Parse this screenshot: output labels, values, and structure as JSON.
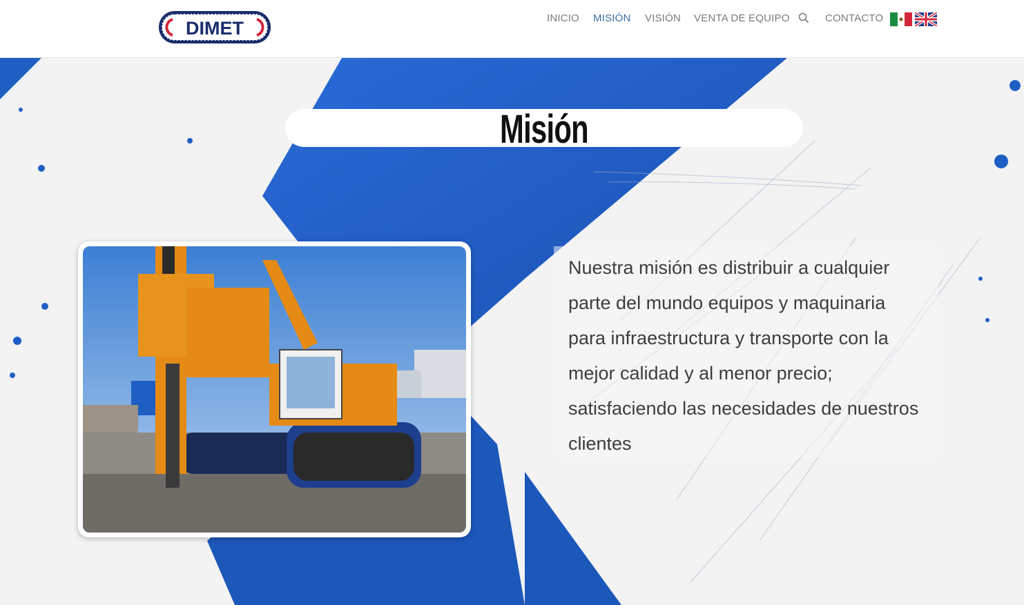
{
  "header": {
    "logo_text": "DIMET",
    "nav": [
      {
        "label": "INICIO",
        "active": false
      },
      {
        "label": "MISIÓN",
        "active": true
      },
      {
        "label": "VISIÓN",
        "active": false
      },
      {
        "label": "VENTA DE EQUIPO",
        "active": false
      },
      {
        "label": "CONTACTO",
        "active": false
      }
    ],
    "search_icon": "search-icon",
    "flags": [
      "mexico-flag-icon",
      "uk-flag-icon"
    ]
  },
  "main": {
    "title": "Misión",
    "mission_text": "Nuestra misión es distribuir a cualquier parte del mundo equipos y maquinaria para infraestructura y transporte con la mejor calidad y al menor precio; satisfaciendo las necesidades de nuestros clientes"
  },
  "colors": {
    "accent_blue": "#1f5fc4",
    "nav_active": "#3b6fa3",
    "nav_text": "#7a7a7a",
    "logo_blue": "#1a2d6b",
    "logo_red": "#d3263a"
  }
}
